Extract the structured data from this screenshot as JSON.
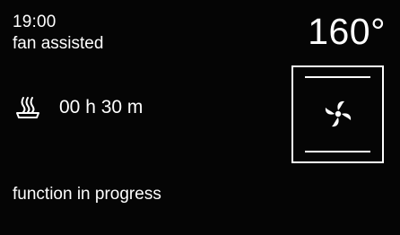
{
  "display": {
    "time": "19:00",
    "mode": "fan assisted",
    "temperature": "160°",
    "duration": "00 h 30 m",
    "status": "function in progress"
  },
  "icons": {
    "cooking": "cooking-dish-icon",
    "fan": "fan-icon",
    "oven": "oven-cavity-icon"
  },
  "colors": {
    "background": "#050505",
    "foreground": "#ffffff"
  }
}
